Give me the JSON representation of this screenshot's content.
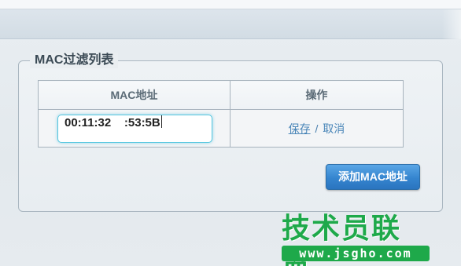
{
  "panel": {
    "legend": "MAC过滤列表"
  },
  "table": {
    "headers": {
      "mac": "MAC地址",
      "operation": "操作"
    },
    "rows": [
      {
        "mac_value": "00:11:32    :53:5B",
        "save_label": "保存",
        "separator": "/",
        "cancel_label": "取消"
      }
    ]
  },
  "add_button": {
    "label": "添加MAC地址"
  },
  "watermark": {
    "title": "技术员联盟",
    "url": "www.jsgho.com"
  },
  "colors": {
    "accent_button": "#3585cf",
    "link": "#4a86b8",
    "input_focus": "#55c6df",
    "watermark_green": "#1ea94a"
  }
}
